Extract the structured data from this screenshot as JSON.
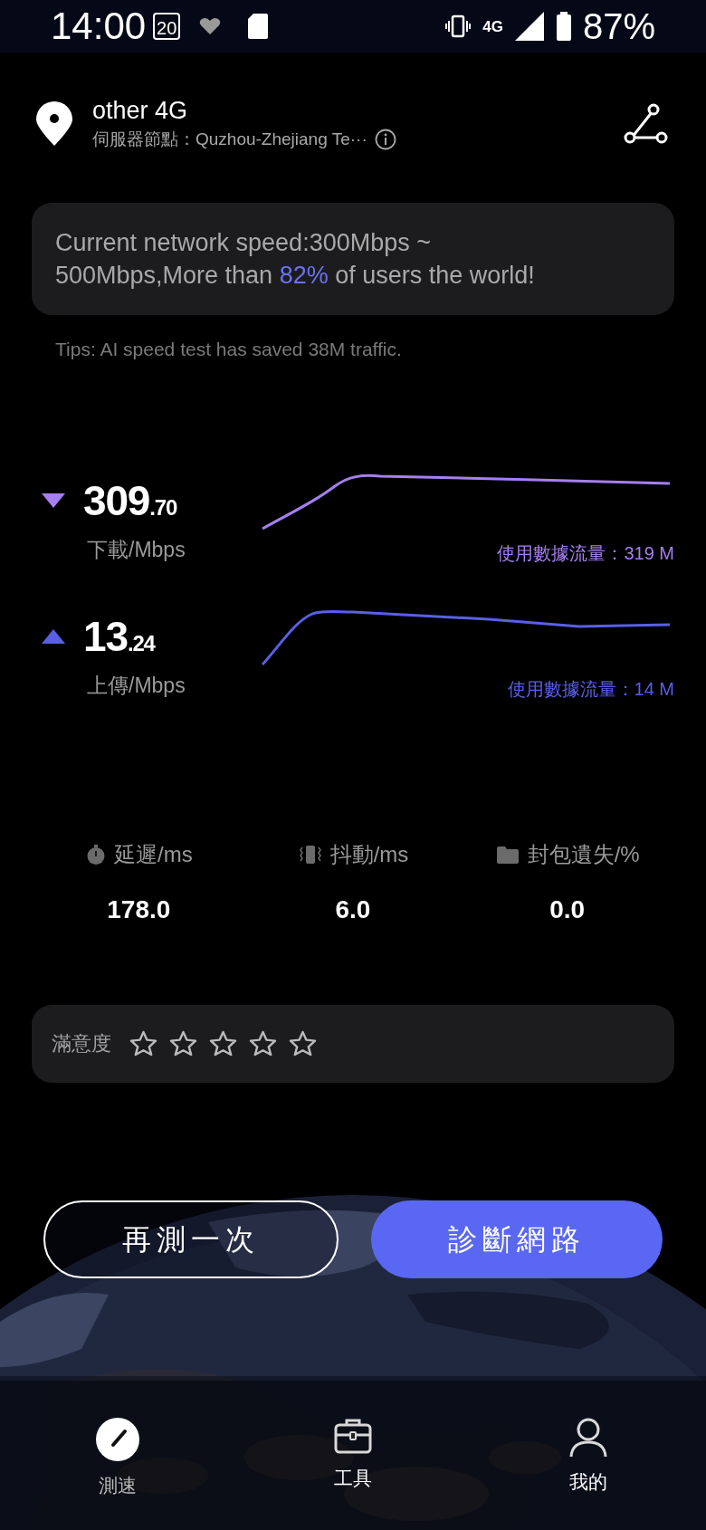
{
  "status_bar": {
    "time": "14:00",
    "date_badge": "20",
    "network": "4G",
    "battery": "87%"
  },
  "header": {
    "title": "other 4G",
    "server": "伺服器節點：Quzhou-Zhejiang Te···"
  },
  "summary": {
    "line_1": "Current network speed:300Mbps ~",
    "text_before": "500Mbps,More than ",
    "highlight": "82%",
    "text_after": " of users the world!",
    "tips": "Tips: AI speed test has saved 38M traffic."
  },
  "speeds": [
    {
      "kind": "download",
      "whole": "309",
      "fraction": ".70",
      "label": "下載/Mbps",
      "usage": "使用數據流量：319 M",
      "color": "#a67ff0"
    },
    {
      "kind": "upload",
      "whole": "13",
      "fraction": ".24",
      "label": "上傳/Mbps",
      "usage": "使用數據流量：14 M",
      "color": "#5a5fe6"
    }
  ],
  "stats": [
    {
      "kind": "latency",
      "label": "延遲/ms",
      "value": "178.0"
    },
    {
      "kind": "jitter",
      "label": "抖動/ms",
      "value": "6.0"
    },
    {
      "kind": "loss",
      "label": "封包遺失/%",
      "value": "0.0"
    }
  ],
  "rating": {
    "label": "滿意度",
    "stars": 0
  },
  "buttons": [
    {
      "kind": "outline",
      "label": "再測一次"
    },
    {
      "kind": "primary",
      "label": "診斷網路"
    }
  ],
  "nav": [
    {
      "kind": "speed",
      "label": "測速",
      "selected": true
    },
    {
      "kind": "tools",
      "label": "工具",
      "selected": false
    },
    {
      "kind": "me",
      "label": "我的",
      "selected": false
    }
  ]
}
